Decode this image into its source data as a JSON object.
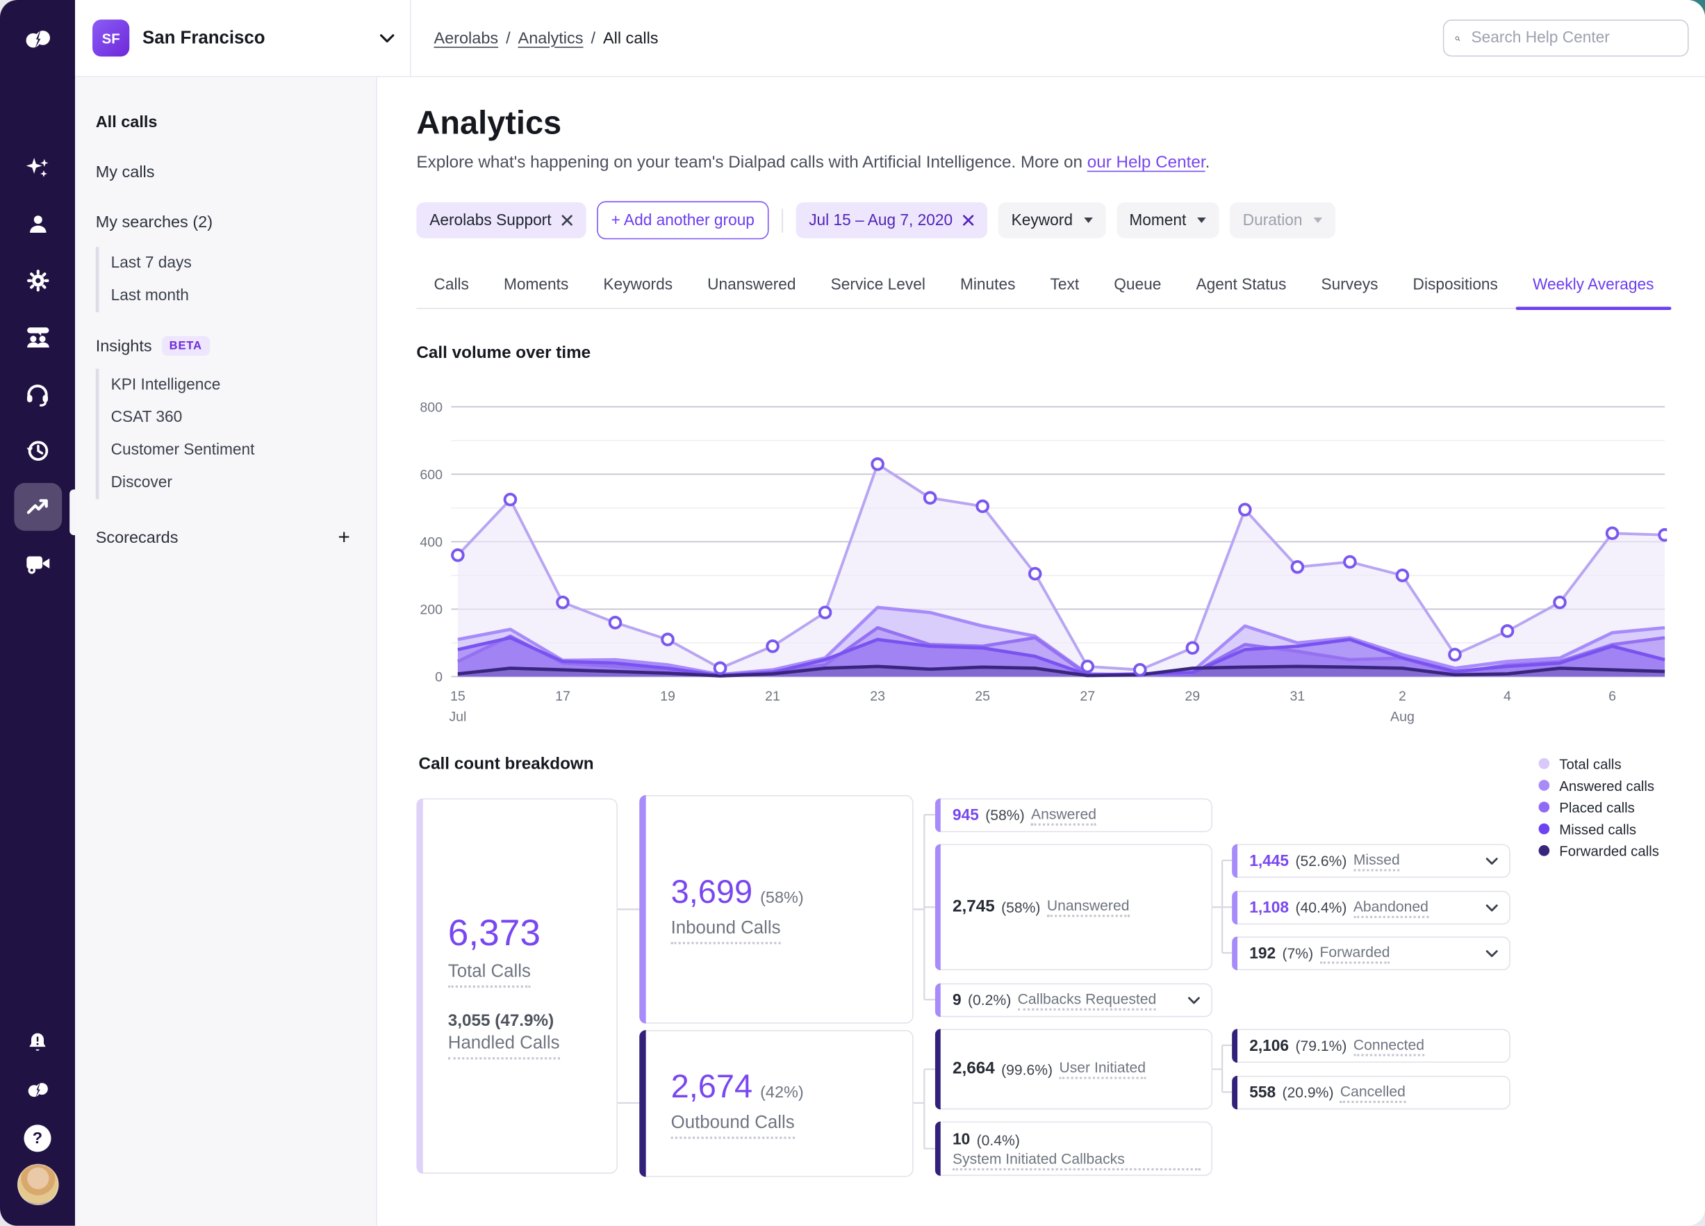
{
  "colors": {
    "accent": "#7847F0",
    "rail_bg": "#211244",
    "sidebar_bg": "#F7F7FA",
    "chip_lavender": "#EDE6FC",
    "dark_node_accent": "#33207A",
    "light_node_accent": "#A78BFA"
  },
  "rail": {
    "icons": [
      "dialpad-logo",
      "ai-sparkles-icon",
      "contacts-icon",
      "settings-icon",
      "coaching-icon",
      "support-headset-icon",
      "history-icon",
      "analytics-icon",
      "meetings-camera-icon",
      "notifications-bell-icon",
      "dialpad-app-icon",
      "help-icon",
      "user-avatar"
    ],
    "active_icon": "analytics-icon",
    "help_glyph": "?"
  },
  "topbar": {
    "workspace_initials": "SF",
    "workspace_name": "San Francisco",
    "breadcrumb": {
      "link1": "Aerolabs",
      "link2": "Analytics",
      "current": "All calls",
      "separator": "/"
    },
    "search_placeholder": "Search Help Center"
  },
  "sidebar": {
    "items": {
      "all_calls": "All calls",
      "my_calls": "My calls",
      "my_searches": "My searches (2)"
    },
    "my_searches_children": [
      "Last 7 days",
      "Last month"
    ],
    "insights_label": "Insights",
    "insights_badge": "BETA",
    "insights_children": [
      "KPI Intelligence",
      "CSAT 360",
      "Customer Sentiment",
      "Discover"
    ],
    "scorecards_label": "Scorecards",
    "scorecards_add": "+"
  },
  "page": {
    "title": "Analytics",
    "subtitle_prefix": "Explore what's happening on your team's Dialpad calls with Artificial Intelligence. More on ",
    "subtitle_link": "our Help Center",
    "subtitle_suffix": "."
  },
  "filters": {
    "group_chip": "Aerolabs Support",
    "add_group": "+ Add another group",
    "date_chip": "Jul 15 – Aug 7, 2020",
    "keyword": "Keyword",
    "moment": "Moment",
    "duration": "Duration"
  },
  "tabs": {
    "items": [
      "Calls",
      "Moments",
      "Keywords",
      "Unanswered",
      "Service Level",
      "Minutes",
      "Text",
      "Queue",
      "Agent Status",
      "Surveys",
      "Dispositions",
      "Weekly Averages"
    ],
    "active": "Weekly Averages"
  },
  "chart_data": {
    "type": "area",
    "title": "Call volume over time",
    "x": [
      "Jul 15",
      "Jul 16",
      "Jul 17",
      "Jul 18",
      "Jul 19",
      "Jul 20",
      "Jul 21",
      "Jul 22",
      "Jul 23",
      "Jul 24",
      "Jul 25",
      "Jul 26",
      "Jul 27",
      "Jul 28",
      "Jul 29",
      "Jul 30",
      "Jul 31",
      "Aug 1",
      "Aug 2",
      "Aug 3",
      "Aug 4",
      "Aug 5",
      "Aug 6",
      "Aug 7"
    ],
    "x_ticks": [
      {
        "i": 0,
        "label": "15",
        "month": "Jul"
      },
      {
        "i": 2,
        "label": "17"
      },
      {
        "i": 4,
        "label": "19"
      },
      {
        "i": 6,
        "label": "21"
      },
      {
        "i": 8,
        "label": "23"
      },
      {
        "i": 10,
        "label": "25"
      },
      {
        "i": 12,
        "label": "27"
      },
      {
        "i": 14,
        "label": "29"
      },
      {
        "i": 16,
        "label": "31"
      },
      {
        "i": 18,
        "label": "2",
        "month": "Aug"
      },
      {
        "i": 20,
        "label": "4"
      },
      {
        "i": 22,
        "label": "6"
      }
    ],
    "ylim": [
      0,
      800
    ],
    "y_major": [
      0,
      200,
      400,
      600,
      800
    ],
    "y_minor": [
      100,
      300,
      500,
      700
    ],
    "grid": true,
    "legend_position": "right",
    "series": [
      {
        "name": "Total calls",
        "color": "#B9A5F2",
        "fill": "rgba(237,232,250,0.62)",
        "marker": true,
        "marker_color": "#7A57EE",
        "values": [
          360,
          525,
          220,
          160,
          110,
          25,
          90,
          190,
          630,
          530,
          505,
          305,
          30,
          20,
          85,
          495,
          325,
          340,
          300,
          65,
          135,
          220,
          425,
          420
        ]
      },
      {
        "name": "Answered calls",
        "color": "#A78BFA",
        "fill": "rgba(167,139,250,0.35)",
        "values": [
          110,
          140,
          48,
          50,
          35,
          6,
          20,
          55,
          205,
          190,
          150,
          120,
          8,
          5,
          15,
          150,
          100,
          115,
          65,
          25,
          45,
          55,
          130,
          145
        ]
      },
      {
        "name": "Placed calls",
        "color": "#9571F2",
        "fill": "rgba(149,113,242,0.40)",
        "values": [
          45,
          120,
          40,
          30,
          20,
          4,
          15,
          35,
          145,
          95,
          90,
          115,
          5,
          4,
          10,
          95,
          75,
          50,
          55,
          10,
          35,
          45,
          95,
          115
        ]
      },
      {
        "name": "Missed calls",
        "color": "#7952F0",
        "fill": "rgba(121,82,240,0.42)",
        "values": [
          80,
          115,
          45,
          40,
          25,
          3,
          12,
          50,
          110,
          90,
          85,
          60,
          5,
          8,
          12,
          80,
          90,
          110,
          55,
          15,
          30,
          40,
          90,
          50
        ]
      },
      {
        "name": "Forwarded calls",
        "color": "#38267D",
        "fill": "rgba(56,38,125,0.28)",
        "values": [
          8,
          25,
          20,
          15,
          10,
          2,
          8,
          25,
          30,
          22,
          28,
          25,
          3,
          5,
          25,
          28,
          30,
          28,
          25,
          5,
          8,
          25,
          20,
          15
        ]
      }
    ]
  },
  "breakdown": {
    "title": "Call count breakdown",
    "legend": [
      {
        "label": "Total calls",
        "color": "#D8C9F8"
      },
      {
        "label": "Answered calls",
        "color": "#A78BFA"
      },
      {
        "label": "Placed calls",
        "color": "#8F6BF5"
      },
      {
        "label": "Missed calls",
        "color": "#6D44F0"
      },
      {
        "label": "Forwarded calls",
        "color": "#38267D"
      }
    ],
    "nodes": {
      "total": {
        "value": "6,373",
        "label": "Total Calls",
        "sub_value": "3,055 (47.9%)",
        "sub_label": "Handled Calls",
        "accent": "#DFD2F9",
        "value_color": "#7847F0"
      },
      "inbound": {
        "value": "3,699",
        "pct": "(58%)",
        "label": "Inbound Calls",
        "accent": "#A78BFA",
        "value_color": "#7847F0"
      },
      "outbound": {
        "value": "2,674",
        "pct": "(42%)",
        "label": "Outbound Calls",
        "accent": "#33207A",
        "value_color": "#7847F0"
      },
      "answered": {
        "value": "945",
        "pct": "(58%)",
        "label": "Answered",
        "accent": "#A78BFA",
        "value_color": "#7847F0"
      },
      "unanswered": {
        "value": "2,745",
        "pct": "(58%)",
        "label": "Unanswered",
        "accent": "#A78BFA",
        "value_color": "#262B35"
      },
      "missed": {
        "value": "1,445",
        "pct": "(52.6%)",
        "label": "Missed",
        "accent": "#A78BFA",
        "value_color": "#7847F0"
      },
      "abandoned": {
        "value": "1,108",
        "pct": "(40.4%)",
        "label": "Abandoned",
        "accent": "#A78BFA",
        "value_color": "#7847F0"
      },
      "forwarded": {
        "value": "192",
        "pct": "(7%)",
        "label": "Forwarded",
        "accent": "#A78BFA",
        "value_color": "#262B35"
      },
      "callbacks": {
        "value": "9",
        "pct": "(0.2%)",
        "label": "Callbacks Requested",
        "accent": "#A78BFA",
        "value_color": "#262B35"
      },
      "user_initiated": {
        "value": "2,664",
        "pct": "(99.6%)",
        "label": "User Initiated",
        "accent": "#33207A",
        "value_color": "#262B35"
      },
      "connected": {
        "value": "2,106",
        "pct": "(79.1%)",
        "label": "Connected",
        "accent": "#33207A",
        "value_color": "#262B35"
      },
      "cancelled": {
        "value": "558",
        "pct": "(20.9%)",
        "label": "Cancelled",
        "accent": "#33207A",
        "value_color": "#262B35"
      },
      "system_callbacks": {
        "value": "10",
        "pct": "(0.4%)",
        "label": "System Initiated Callbacks",
        "accent": "#33207A",
        "value_color": "#262B35"
      }
    }
  }
}
